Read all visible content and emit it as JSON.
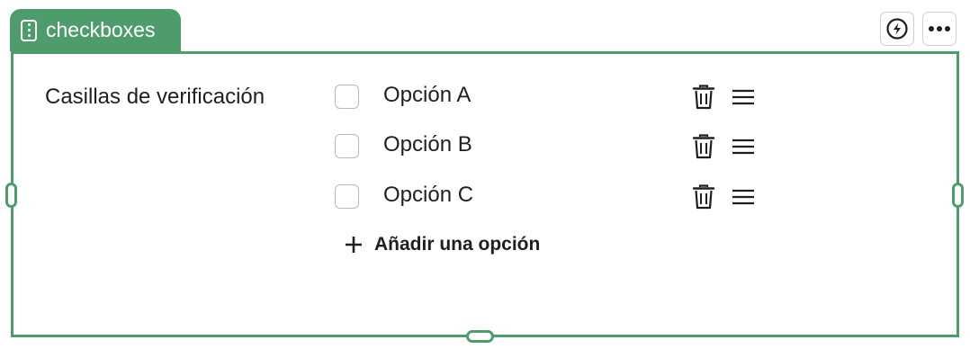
{
  "block": {
    "type_label": "checkboxes",
    "field_label": "Casillas de verificación"
  },
  "toolbar": {
    "actions": [
      {
        "icon": "lightning-icon"
      },
      {
        "icon": "more-horizontal-icon"
      }
    ]
  },
  "options": [
    {
      "label": "Opción A",
      "checked": false
    },
    {
      "label": "Opción B",
      "checked": false
    },
    {
      "label": "Opción C",
      "checked": false
    }
  ],
  "add_option_label": "Añadir una opción",
  "colors": {
    "accent": "#4e9c6c",
    "text": "#1f1f1f",
    "border": "#b9b9b9"
  }
}
